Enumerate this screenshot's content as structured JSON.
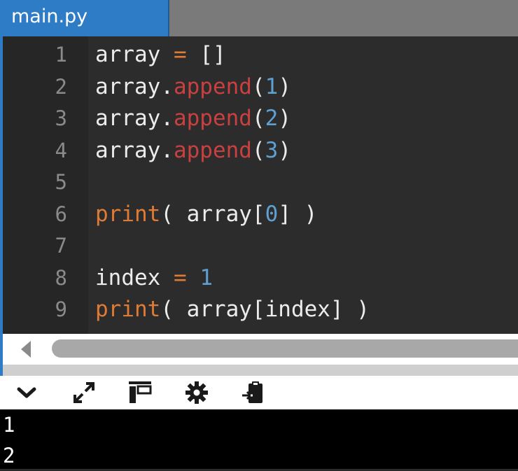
{
  "tab": {
    "filename": "main.py"
  },
  "editor": {
    "lines": [
      {
        "n": "1",
        "tokens": [
          [
            "array",
            "plain"
          ],
          [
            " = ",
            "op"
          ],
          [
            "[]",
            "plain"
          ]
        ]
      },
      {
        "n": "2",
        "tokens": [
          [
            "array.",
            "plain"
          ],
          [
            "append",
            "fn"
          ],
          [
            "(",
            "plain"
          ],
          [
            "1",
            "num"
          ],
          [
            ")",
            "plain"
          ]
        ]
      },
      {
        "n": "3",
        "tokens": [
          [
            "array.",
            "plain"
          ],
          [
            "append",
            "fn"
          ],
          [
            "(",
            "plain"
          ],
          [
            "2",
            "num"
          ],
          [
            ")",
            "plain"
          ]
        ]
      },
      {
        "n": "4",
        "tokens": [
          [
            "array.",
            "plain"
          ],
          [
            "append",
            "fn"
          ],
          [
            "(",
            "plain"
          ],
          [
            "3",
            "num"
          ],
          [
            ")",
            "plain"
          ]
        ]
      },
      {
        "n": "5",
        "tokens": []
      },
      {
        "n": "6",
        "tokens": [
          [
            "print",
            "print"
          ],
          [
            "( array[",
            "plain"
          ],
          [
            "0",
            "num"
          ],
          [
            "] )",
            "plain"
          ]
        ]
      },
      {
        "n": "7",
        "tokens": []
      },
      {
        "n": "8",
        "tokens": [
          [
            "index",
            "plain"
          ],
          [
            " = ",
            "op"
          ],
          [
            "1",
            "num"
          ]
        ]
      },
      {
        "n": "9",
        "tokens": [
          [
            "print",
            "print"
          ],
          [
            "( array[index] )",
            "plain"
          ]
        ]
      }
    ]
  },
  "toolbar": {
    "icons": [
      "chevron-down-icon",
      "expand-icon",
      "layout-panel-icon",
      "gear-icon",
      "clipboard-paste-icon"
    ]
  },
  "console": {
    "output": [
      "1",
      "2"
    ]
  },
  "colors": {
    "accent": "#2f7cc6",
    "operator": "#e07b35",
    "function": "#c94040",
    "number": "#5fa0d0"
  }
}
